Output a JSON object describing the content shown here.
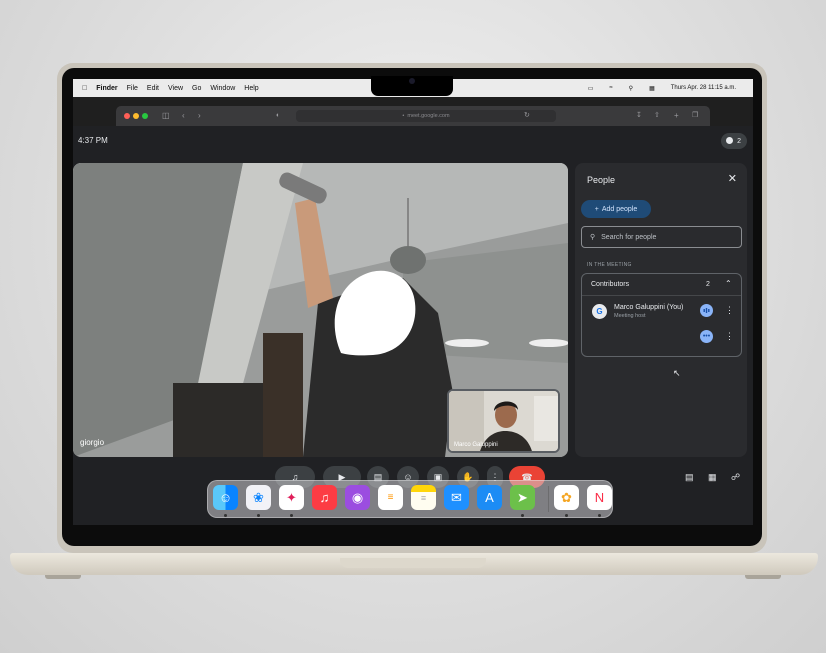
{
  "menubar": {
    "app": "Finder",
    "menus": [
      "File",
      "Edit",
      "View",
      "Go",
      "Window",
      "Help"
    ],
    "clock": "Thurs Apr. 28 11:15 a.m."
  },
  "browser": {
    "url": "meet.google.com"
  },
  "meet": {
    "time": "4:37 PM",
    "participant_count": "2",
    "main_video_name": "giorgio",
    "pip_name": "Marco Galuppini"
  },
  "people_panel": {
    "title": "People",
    "add_people_label": "Add people",
    "search_placeholder": "Search for people",
    "section_label": "IN THE MEETING",
    "contributors_label": "Contributors",
    "contributors_count": "2",
    "person_name": "Marco Galuppini (You)",
    "person_role": "Meeting host",
    "avatar_letter": "G"
  },
  "colors": {
    "meet_bg": "#202124",
    "panel_bg": "#2a2b2e",
    "end_call": "#ea4335",
    "accent": "#8ab4f8"
  },
  "dock": {
    "apps": [
      "finder-icon",
      "safari-icon",
      "slack-icon",
      "music-icon",
      "podcasts-icon",
      "reminders-icon",
      "notes-icon",
      "mail-icon",
      "app-store-icon",
      "maps-icon",
      "photos-icon",
      "news-icon"
    ]
  }
}
